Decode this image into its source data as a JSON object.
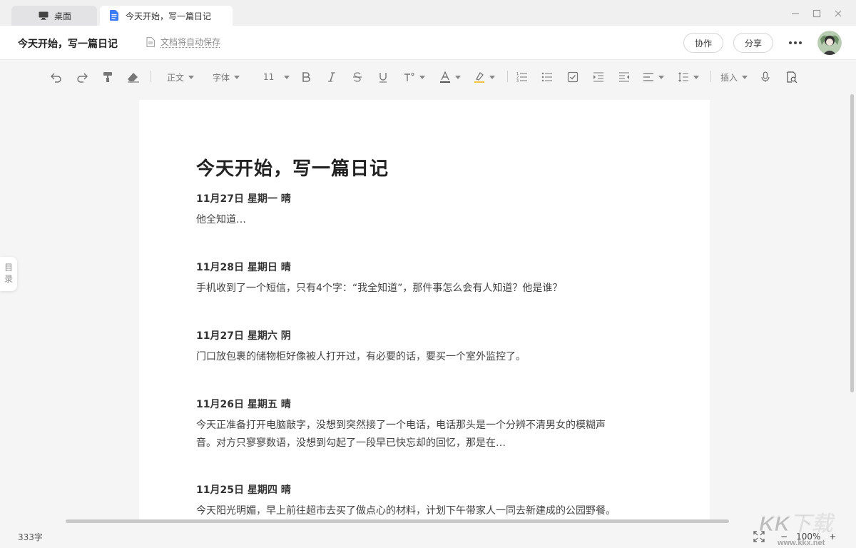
{
  "tabs": [
    {
      "label": "桌面",
      "icon": "monitor-icon",
      "active": false
    },
    {
      "label": "今天开始，写一篇日记",
      "icon": "document-icon",
      "active": true
    }
  ],
  "header": {
    "doc_title": "今天开始，写一篇日记",
    "autosave_text": "文档将自动保存",
    "collab_label": "协作",
    "share_label": "分享"
  },
  "toolbar": {
    "style_label": "正文",
    "font_label": "字体",
    "size_label": "11",
    "insert_label": "插入"
  },
  "document": {
    "title": "今天开始，写一篇日记",
    "entries": [
      {
        "date": "11月27日 星期一 晴",
        "lines": [
          "他全知道…"
        ]
      },
      {
        "date": "11月28日 星期日 晴",
        "lines": [
          "手机收到了一个短信，只有4个字：“我全知道”，那件事怎么会有人知道？他是谁？"
        ]
      },
      {
        "date": "11月27日 星期六 阴",
        "lines": [
          "门口放包裹的储物柜好像被人打开过，有必要的话，要买一个室外监控了。"
        ]
      },
      {
        "date": "11月26日 星期五 晴",
        "lines": [
          "今天正准备打开电脑敲字，没想到突然接了一个电话，电话那头是一个分辨不清男女的模糊声",
          "音。对方只寥寥数语，没想到勾起了一段早已快忘却的回忆，那是在…"
        ]
      },
      {
        "date": "11月25日 星期四 晴",
        "lines": [
          "今天阳光明媚，早上前往超市去买了做点心的材料，计划下午带家人一同去新建成的公园野餐。"
        ]
      }
    ]
  },
  "outline_label": [
    "目",
    "录"
  ],
  "status": {
    "word_count": "333字",
    "zoom": "100%",
    "zoom_out": "−",
    "zoom_in": "+"
  },
  "watermark": {
    "brand": "KK下载",
    "url": "www.kkx.net"
  },
  "colors": {
    "accent_blue": "#3d7cf5",
    "highlight_yellow": "#f5c242",
    "page_bg": "#ffffff",
    "app_bg": "#f5f5f6"
  }
}
